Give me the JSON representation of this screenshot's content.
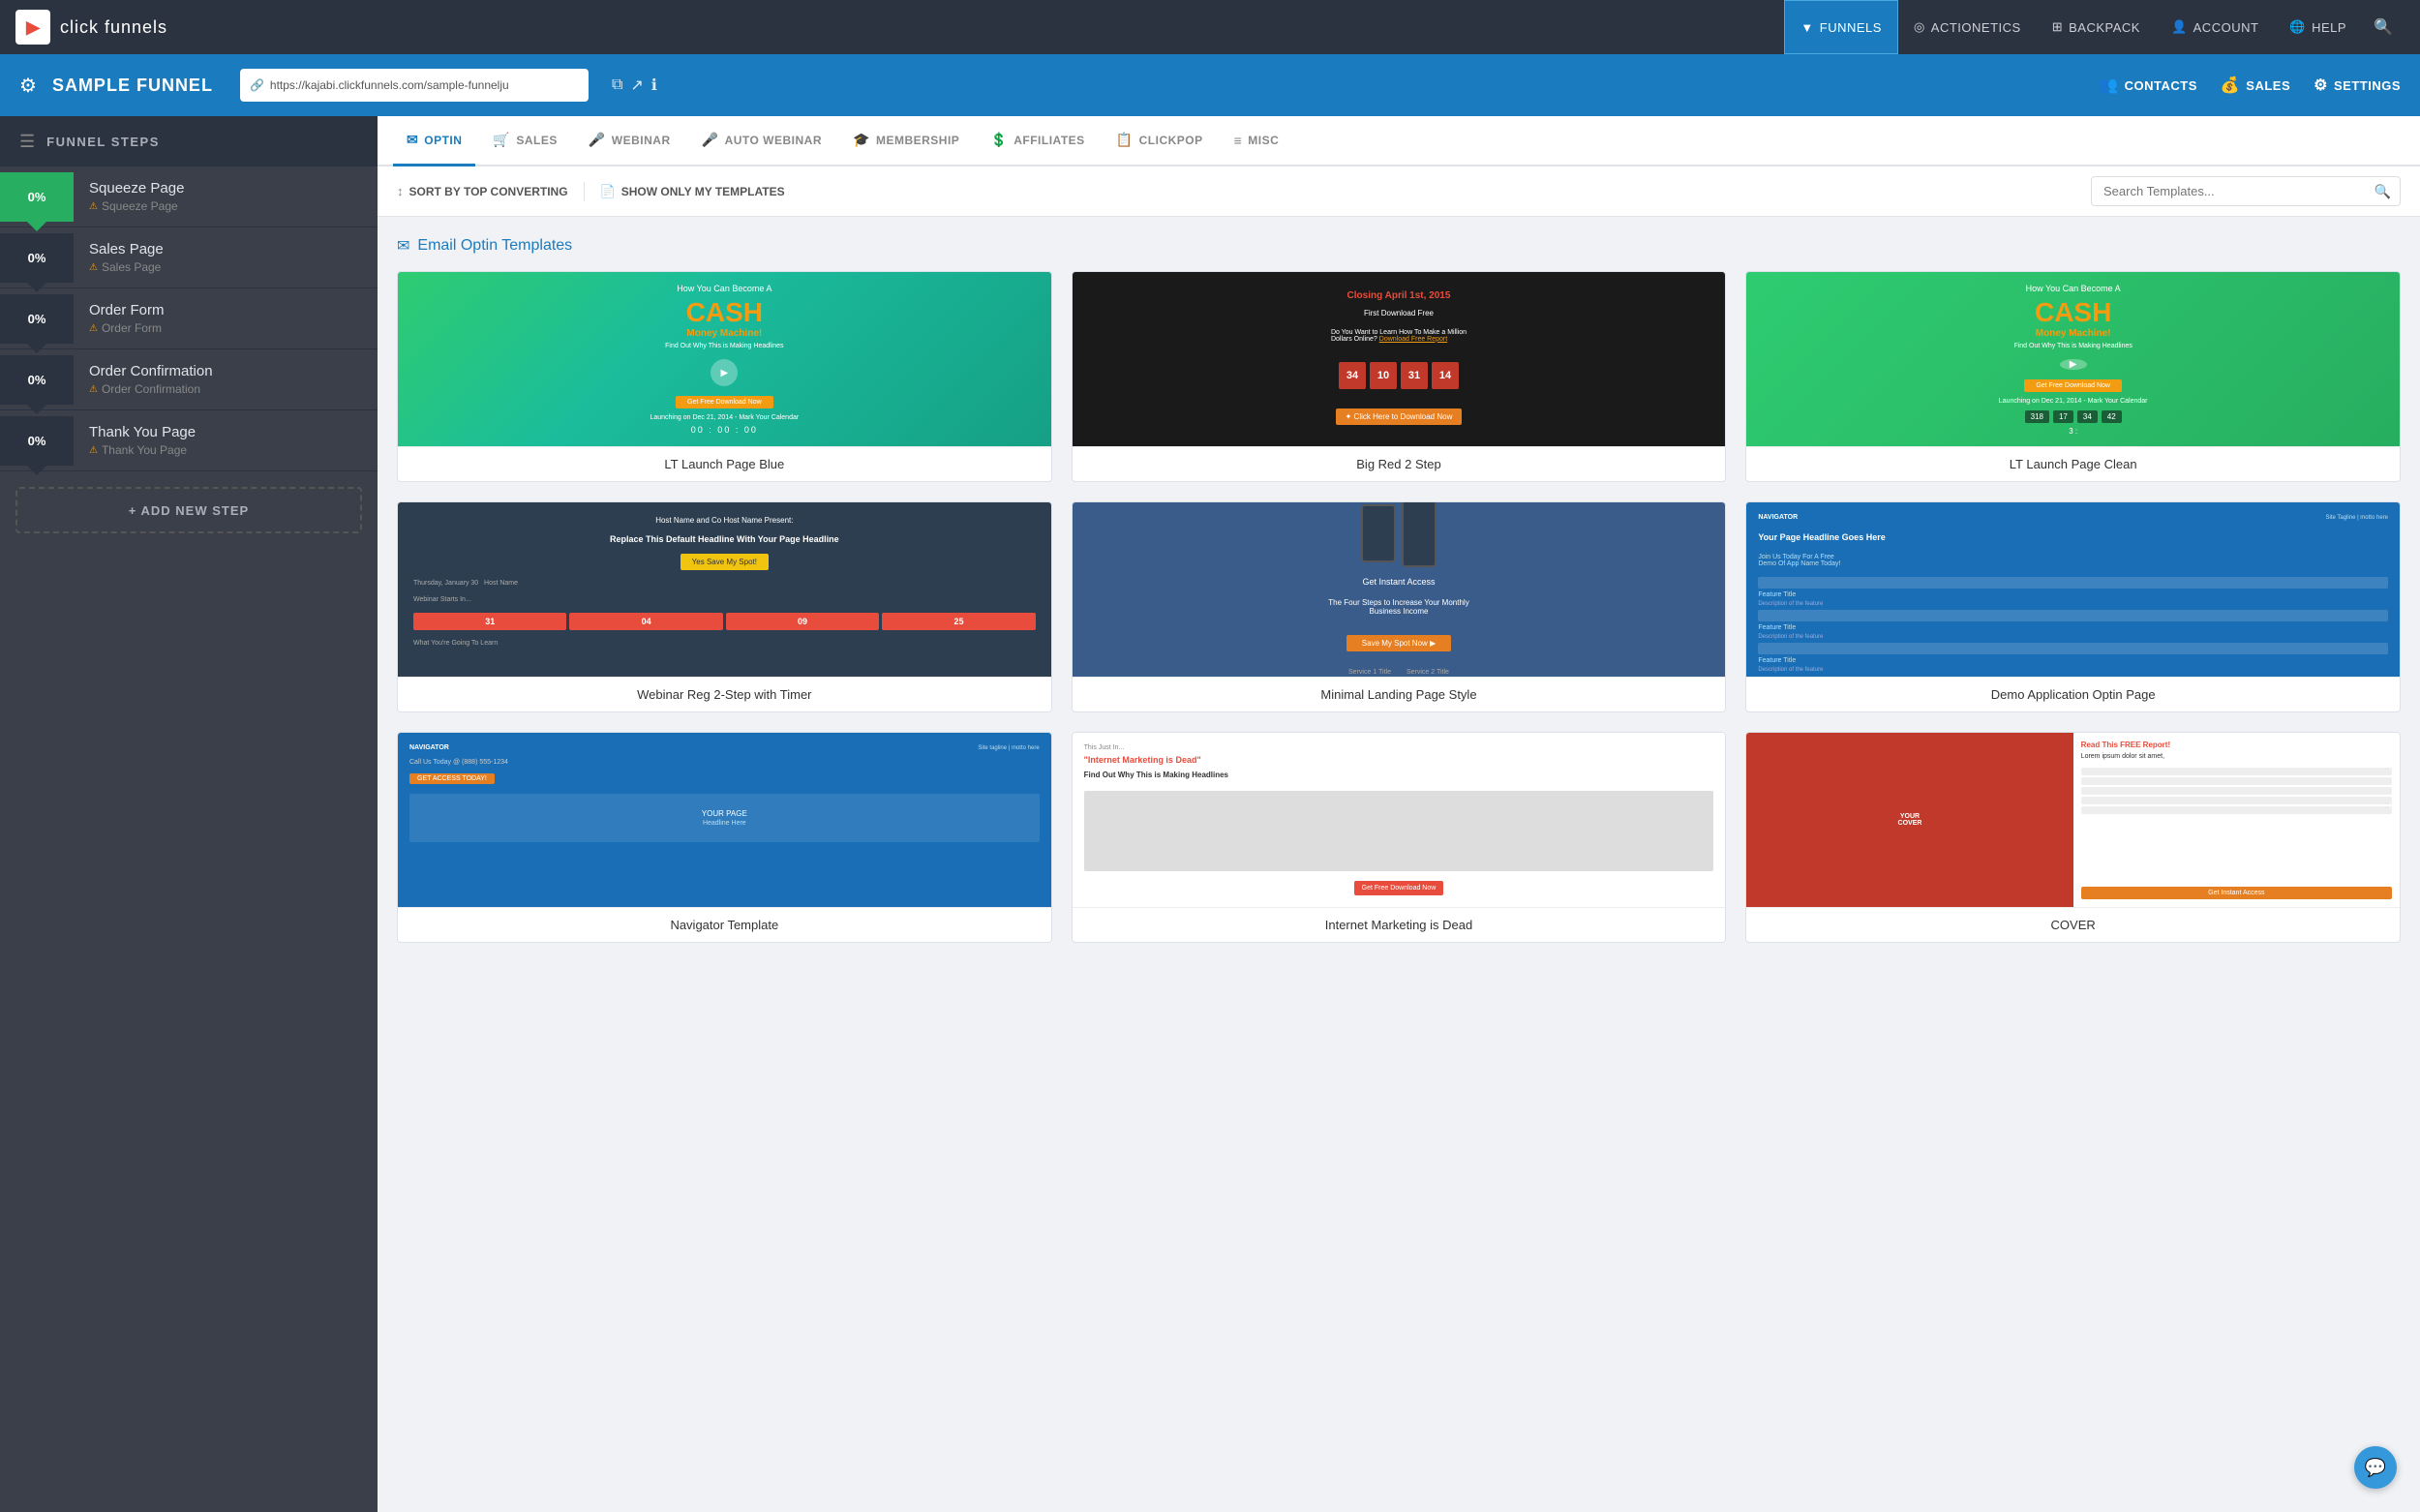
{
  "topNav": {
    "logoText": "click funnels",
    "items": [
      {
        "id": "funnels",
        "label": "FUNNELS",
        "icon": "▼",
        "active": true
      },
      {
        "id": "actionetics",
        "label": "ACTIONETICS",
        "icon": "◎"
      },
      {
        "id": "backpack",
        "label": "BACKPACK",
        "icon": "🎒"
      },
      {
        "id": "account",
        "label": "ACCOUNT",
        "icon": "👤"
      },
      {
        "id": "help",
        "label": "HELP",
        "icon": "🌐"
      }
    ],
    "searchIcon": "🔍"
  },
  "funnelHeader": {
    "title": "SAMPLE FUNNEL",
    "url": "https://kajabi.clickfunnels.com/sample-funnelju",
    "actions": [
      {
        "id": "contacts",
        "label": "CONTACTS",
        "icon": "👥"
      },
      {
        "id": "sales",
        "label": "SALES",
        "icon": "💰"
      },
      {
        "id": "settings",
        "label": "SETTINGS",
        "icon": "⚙"
      }
    ]
  },
  "sidebar": {
    "headerLabel": "FUNNEL STEPS",
    "items": [
      {
        "id": "squeeze",
        "percent": "0%",
        "title": "Squeeze Page",
        "sub": "Squeeze Page",
        "active": true,
        "badgeColor": "green"
      },
      {
        "id": "sales",
        "percent": "0%",
        "title": "Sales Page",
        "sub": "Sales Page",
        "badgeColor": "dark"
      },
      {
        "id": "order-form",
        "percent": "0%",
        "title": "Order Form",
        "sub": "Order Form",
        "badgeColor": "dark"
      },
      {
        "id": "order-confirm",
        "percent": "0%",
        "title": "Order Confirmation",
        "sub": "Order Confirmation",
        "badgeColor": "dark"
      },
      {
        "id": "thank-you",
        "percent": "0%",
        "title": "Thank You Page",
        "sub": "Thank You Page",
        "badgeColor": "dark"
      }
    ],
    "addStepLabel": "+ ADD NEW STEP"
  },
  "tabs": [
    {
      "id": "optin",
      "label": "OPTIN",
      "icon": "✉",
      "active": true
    },
    {
      "id": "sales",
      "label": "SALES",
      "icon": "🛒"
    },
    {
      "id": "webinar",
      "label": "WEBINAR",
      "icon": "🎤"
    },
    {
      "id": "auto-webinar",
      "label": "AUTO WEBINAR",
      "icon": "🎤"
    },
    {
      "id": "membership",
      "label": "MEMBERSHIP",
      "icon": "🎓"
    },
    {
      "id": "affiliates",
      "label": "AFFILIATES",
      "icon": "💲"
    },
    {
      "id": "clickpop",
      "label": "CLICKPOP",
      "icon": "📋"
    },
    {
      "id": "misc",
      "label": "MISC",
      "icon": "≡"
    }
  ],
  "filterBar": {
    "sortByLabel": "SORT BY TOP CONVERTING",
    "showOnlyLabel": "SHOW ONLY MY TEMPLATES",
    "searchPlaceholder": "Search Templates..."
  },
  "sectionTitle": "Email Optin Templates",
  "templates": [
    {
      "id": "lt-launch-blue",
      "name": "LT Launch Page Blue",
      "type": "lt-blue"
    },
    {
      "id": "big-red-2step",
      "name": "Big Red 2 Step",
      "type": "big-red"
    },
    {
      "id": "lt-launch-clean",
      "name": "LT Launch Page Clean",
      "type": "lt-clean"
    },
    {
      "id": "webinar-reg-2step",
      "name": "Webinar Reg 2-Step with Timer",
      "type": "webinar"
    },
    {
      "id": "minimal-landing",
      "name": "Minimal Landing Page Style",
      "type": "minimal"
    },
    {
      "id": "demo-application",
      "name": "Demo Application Optin Page",
      "type": "demo"
    },
    {
      "id": "navigator-1",
      "name": "Navigator Template",
      "type": "navigator"
    },
    {
      "id": "internet-dead",
      "name": "Internet Marketing is Dead",
      "type": "internet"
    },
    {
      "id": "cover-page",
      "name": "COVER",
      "type": "cover"
    }
  ],
  "countdown": {
    "days": "34",
    "hours": "10",
    "minutes": "31",
    "seconds": "14"
  },
  "countdown2": {
    "val1": "318",
    "val2": "17",
    "val3": "34",
    "val4": "42",
    "val5": "3"
  }
}
